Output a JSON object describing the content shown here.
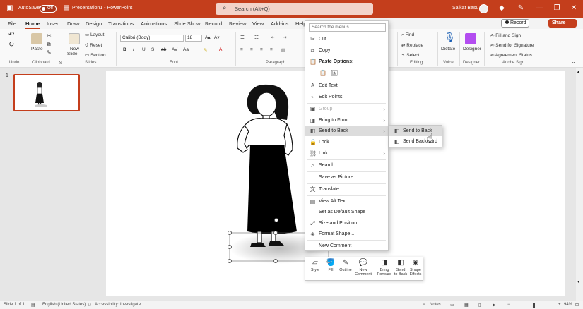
{
  "titlebar": {
    "autosave_label": "AutoSave",
    "autosave_state": "Off",
    "title": "Presentation1  -  PowerPoint",
    "search_placeholder": "Search (Alt+Q)",
    "user_name": "Saikat Basu"
  },
  "tabs": [
    "File",
    "Home",
    "Insert",
    "Draw",
    "Design",
    "Transitions",
    "Animations",
    "Slide Show",
    "Record",
    "Review",
    "View",
    "Add-ins",
    "Help"
  ],
  "record_label": "Record",
  "share_label": "Share",
  "ribbon": {
    "paste": "Paste",
    "new_slide_1": "New",
    "new_slide_2": "Slide",
    "layout": "Layout",
    "reset": "Reset",
    "section": "Section",
    "font_name": "Calibri (Body)",
    "font_size": "18",
    "find": "Find",
    "replace": "Replace",
    "select": "Select",
    "dictate": "Dictate",
    "designer": "Designer",
    "fill_sign": "Fill and Sign",
    "send_signature": "Send for Signature",
    "agreement_status": "Agreement Status",
    "groups": {
      "undo": "Undo",
      "clipboard": "Clipboard",
      "slides": "Slides",
      "font": "Font",
      "paragraph": "Paragraph",
      "editing": "Editing",
      "voice": "Voice",
      "designer": "Designer",
      "adobe": "Adobe Sign"
    }
  },
  "slides_panel": {
    "slide_number": "1"
  },
  "context_menu": {
    "search_placeholder": "Search the menus",
    "items": {
      "cut": "Cut",
      "copy": "Copy",
      "paste_options": "Paste Options:",
      "edit_text": "Edit Text",
      "edit_points": "Edit Points",
      "group": "Group",
      "bring_front": "Bring to Front",
      "send_back": "Send to Back",
      "lock": "Lock",
      "link": "Link",
      "search": "Search",
      "save_picture": "Save as Picture...",
      "translate": "Translate",
      "alt_text": "View Alt Text...",
      "default_shape": "Set as Default Shape",
      "size_position": "Size and Position...",
      "format_shape": "Format Shape...",
      "new_comment": "New Comment"
    }
  },
  "submenu": {
    "send_to_back": "Send to Back",
    "send_backward": "Send Backward"
  },
  "mini_toolbar": {
    "style": "Style",
    "fill": "Fill",
    "outline": "Outline",
    "new_comment_1": "New",
    "new_comment_2": "Comment",
    "bring_forward_1": "Bring",
    "bring_forward_2": "Forward",
    "send_back_1": "Send",
    "send_back_2": "to Back",
    "shape_effects_1": "Shape",
    "shape_effects_2": "Effects"
  },
  "statusbar": {
    "slide_of": "Slide 1 of 1",
    "language": "English (United States)",
    "accessibility": "Accessibility: Investigate",
    "notes": "Notes",
    "zoom": "94%"
  },
  "colors": {
    "accent": "#c43e1c",
    "menu_highlight": "#dcdcdc"
  }
}
